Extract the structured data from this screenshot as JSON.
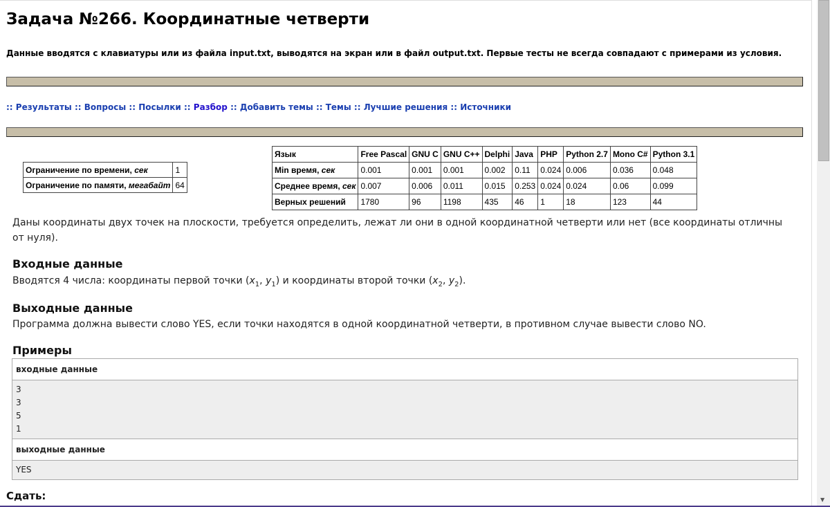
{
  "title": "Задача №266. Координатные четверти",
  "io_note": "Данные вводятся с клавиатуры или из файла input.txt, выводятся на экран или в файл output.txt. Первые тесты не всегда совпадают с примерами из условия.",
  "nav": {
    "sep": "::",
    "links": [
      "Результаты",
      "Вопросы",
      "Посылки",
      "Разбор",
      "Добавить темы",
      "Темы",
      "Лучшие решения",
      "Источники"
    ]
  },
  "limits": [
    {
      "label": "Ограничение по времени, ",
      "unit": "сек",
      "value": "1"
    },
    {
      "label": "Ограничение по памяти, ",
      "unit": "мегабайт",
      "value": "64"
    }
  ],
  "stats": {
    "header": [
      "Язык",
      "Free Pascal",
      "GNU C",
      "GNU C++",
      "Delphi",
      "Java",
      "PHP",
      "Python 2.7",
      "Mono C#",
      "Python 3.1"
    ],
    "rows": [
      {
        "label": "Min время, ",
        "unit": "сек",
        "values": [
          "0.001",
          "0.001",
          "0.001",
          "0.002",
          "0.11",
          "0.024",
          "0.006",
          "0.036",
          "0.048"
        ]
      },
      {
        "label": "Среднее время, ",
        "unit": "сек",
        "values": [
          "0.007",
          "0.006",
          "0.011",
          "0.015",
          "0.253",
          "0.024",
          "0.024",
          "0.06",
          "0.099"
        ]
      },
      {
        "label": "Верных решений",
        "unit": "",
        "values": [
          "1780",
          "96",
          "1198",
          "435",
          "46",
          "1",
          "18",
          "123",
          "44"
        ]
      }
    ]
  },
  "statement": "Даны координаты двух точек на плоскости, требуется определить, лежат ли они в одной координатной четверти или нет (все координаты отличны от нуля).",
  "input_heading": "Входные данные",
  "input_text": {
    "a": "Вводятся 4 числа: координаты первой точки (",
    "x1": "x",
    "s1": "1",
    "c1": ", ",
    "y1": "y",
    "s2": "1",
    "b": ") и координаты второй точки (",
    "x2": "x",
    "s3": "2",
    "c2": ", ",
    "y2": "y",
    "s4": "2",
    "e": ")."
  },
  "output_heading": "Выходные данные",
  "output_text": "Программа должна вывести слово YES, если точки находятся в одной координатной четверти, в противном случае вывести слово NO.",
  "examples_heading": "Примеры",
  "example": {
    "in_label": "входные данные",
    "in_lines": [
      "3",
      "3",
      "5",
      "1"
    ],
    "out_label": "выходные данные",
    "out_lines": [
      "YES"
    ]
  },
  "submit_heading": "Сдать:"
}
